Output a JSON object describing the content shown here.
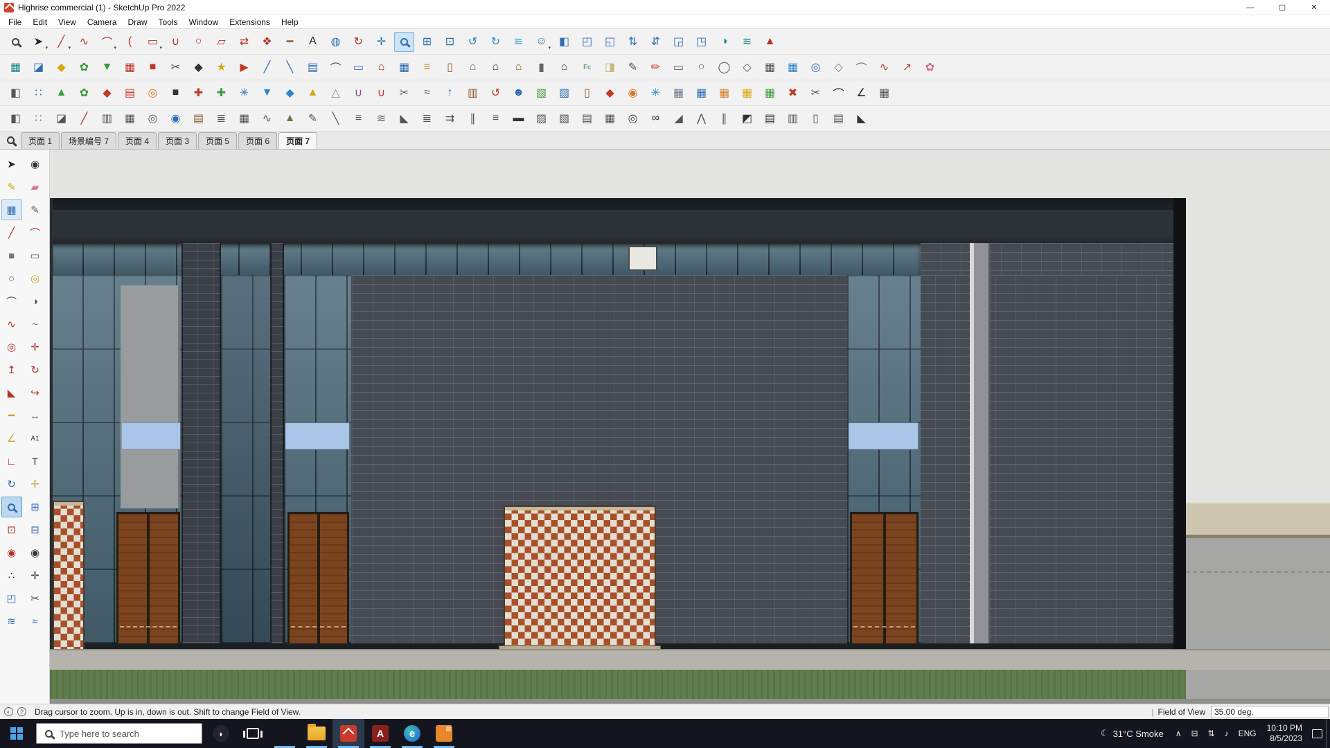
{
  "window": {
    "title": "Highrise commercial (1) - SketchUp Pro 2022",
    "controls": {
      "minimize": "—",
      "maximize": "▢",
      "close": "✕"
    }
  },
  "menu": {
    "items": [
      "File",
      "Edit",
      "View",
      "Camera",
      "Draw",
      "Tools",
      "Window",
      "Extensions",
      "Help"
    ]
  },
  "toolbars": {
    "row1": [
      {
        "n": "zoom",
        "g": "MAG",
        "c": "#444"
      },
      {
        "n": "select",
        "g": "➤",
        "c": "#222",
        "caret": true
      },
      {
        "n": "line",
        "g": "╱",
        "c": "#b3342a",
        "caret": true
      },
      {
        "n": "freehand",
        "g": "∿",
        "c": "#b3342a"
      },
      {
        "n": "arc",
        "g": "⌒",
        "c": "#b3342a",
        "caret": true
      },
      {
        "n": "two-point-arc",
        "g": "(",
        "c": "#b3342a"
      },
      {
        "n": "rectangle",
        "g": "▭",
        "c": "#b3342a",
        "caret": true
      },
      {
        "n": "weld-edges",
        "g": "∪",
        "c": "#b3342a"
      },
      {
        "n": "circle",
        "g": "○",
        "c": "#b3342a"
      },
      {
        "n": "rotated-rectangle",
        "g": "▱",
        "c": "#b3342a"
      },
      {
        "n": "flip",
        "g": "⇄",
        "c": "#b3342a"
      },
      {
        "n": "make-component",
        "g": "❖",
        "c": "#b3342a"
      },
      {
        "n": "tape-measure",
        "g": "━",
        "c": "#8a6d1a"
      },
      {
        "n": "text",
        "g": "A",
        "c": "#222"
      },
      {
        "n": "paint-bucket",
        "g": "◍",
        "c": "#2e6db4"
      },
      {
        "n": "orbit",
        "g": "↻",
        "c": "#b3342a"
      },
      {
        "n": "pan",
        "g": "✛",
        "c": "#2e6db4"
      },
      {
        "n": "zoom-tool",
        "g": "MAG",
        "c": "#2e6db4",
        "sel": true
      },
      {
        "n": "zoom-window",
        "g": "⊞",
        "c": "#2e6db4"
      },
      {
        "n": "zoom-extents",
        "g": "⊡",
        "c": "#2e6db4"
      },
      {
        "n": "previous-view",
        "g": "↺",
        "c": "#2e86c8"
      },
      {
        "n": "next-view",
        "g": "↻",
        "c": "#2e86c8"
      },
      {
        "n": "layers-water",
        "g": "≋",
        "c": "#3aa0c8"
      },
      {
        "n": "position-camera",
        "g": "☺",
        "c": "#2e6db4",
        "caret": true
      },
      {
        "n": "view-iso",
        "g": "◧",
        "c": "#2e6db4"
      },
      {
        "n": "view-top",
        "g": "◰",
        "c": "#2e6db4"
      },
      {
        "n": "view-front",
        "g": "◱",
        "c": "#2e6db4"
      },
      {
        "n": "view-up",
        "g": "⇅",
        "c": "#2e6db4"
      },
      {
        "n": "view-back",
        "g": "⇵",
        "c": "#2e6db4"
      },
      {
        "n": "view-left",
        "g": "◲",
        "c": "#2e6db4"
      },
      {
        "n": "view-bottom",
        "g": "◳",
        "c": "#2e6db4"
      },
      {
        "n": "shadows",
        "g": "◑",
        "c": "#16808a"
      },
      {
        "n": "fog",
        "g": "≋",
        "c": "#16808a"
      },
      {
        "n": "match-photo",
        "g": "▲",
        "c": "#b3342a"
      }
    ],
    "row2": [
      {
        "n": "cube-teal",
        "g": "▦",
        "c": "#1f8a8a"
      },
      {
        "n": "cube-blue",
        "g": "◪",
        "c": "#2e6db4"
      },
      {
        "n": "hex-yellow",
        "g": "◆",
        "c": "#d8a612"
      },
      {
        "n": "leaf-green",
        "g": "✿",
        "c": "#3a9a3a"
      },
      {
        "n": "drop-green",
        "g": "▼",
        "c": "#3a9a3a"
      },
      {
        "n": "box-red",
        "g": "▦",
        "c": "#c03a2a"
      },
      {
        "n": "square-red",
        "g": "■",
        "c": "#c03a2a"
      },
      {
        "n": "cut-gray",
        "g": "✂",
        "c": "#555"
      },
      {
        "n": "solid-dark",
        "g": "◆",
        "c": "#333"
      },
      {
        "n": "star-yellow",
        "g": "★",
        "c": "#d8a612"
      },
      {
        "n": "flag-red",
        "g": "▶",
        "c": "#c03a2a"
      },
      {
        "n": "slope-blue",
        "g": "╱",
        "c": "#2e6db4"
      },
      {
        "n": "slope-blue-2",
        "g": "╲",
        "c": "#2e6db4"
      },
      {
        "n": "panel-blue",
        "g": "▤",
        "c": "#2e6db4"
      },
      {
        "n": "arc-gray",
        "g": "⌒",
        "c": "#555"
      },
      {
        "n": "ruler-blue",
        "g": "▭",
        "c": "#2e6db4"
      },
      {
        "n": "roof-red",
        "g": "⌂",
        "c": "#b3342a"
      },
      {
        "n": "grid-blue",
        "g": "▦",
        "c": "#2e6db4"
      },
      {
        "n": "stairs-yellow",
        "g": "≡",
        "c": "#c08a2a"
      },
      {
        "n": "door-brown",
        "g": "▯",
        "c": "#8a5a2a"
      },
      {
        "n": "house-gray",
        "g": "⌂",
        "c": "#666"
      },
      {
        "n": "house-dark",
        "g": "⌂",
        "c": "#333"
      },
      {
        "n": "house-brown",
        "g": "⌂",
        "c": "#8a5a2a"
      },
      {
        "n": "column-gray",
        "g": "▮",
        "c": "#666"
      },
      {
        "n": "house-2",
        "g": "⌂",
        "c": "#444"
      },
      {
        "n": "fc-tool",
        "g": "Fc",
        "c": "#2e8a4a"
      },
      {
        "n": "note-tag",
        "g": "◨",
        "c": "#c8b87a"
      },
      {
        "n": "pencil-gray",
        "g": "✎",
        "c": "#555"
      },
      {
        "n": "marker-red",
        "g": "✏",
        "c": "#c03a2a"
      },
      {
        "n": "rect-outline",
        "g": "▭",
        "c": "#555"
      },
      {
        "n": "circle-outline",
        "g": "○",
        "c": "#555"
      },
      {
        "n": "ellipse-outline",
        "g": "◯",
        "c": "#555"
      },
      {
        "n": "hex-outline",
        "g": "◇",
        "c": "#555"
      },
      {
        "n": "grid-outline",
        "g": "▦",
        "c": "#555"
      },
      {
        "n": "grid-blue-2",
        "g": "▦",
        "c": "#2e86c8"
      },
      {
        "n": "target-blue",
        "g": "◎",
        "c": "#2e6db4"
      },
      {
        "n": "polygon-tool",
        "g": "◇",
        "c": "#777"
      },
      {
        "n": "arc-tool",
        "g": "⌒",
        "c": "#777"
      },
      {
        "n": "curve-red",
        "g": "∿",
        "c": "#c03a2a"
      },
      {
        "n": "arrow-red",
        "g": "↗",
        "c": "#c03a2a"
      },
      {
        "n": "pink-tool",
        "g": "✿",
        "c": "#d06a9a"
      }
    ],
    "row3": [
      {
        "n": "box-3d",
        "g": "◧",
        "c": "#555"
      },
      {
        "n": "dots-blue",
        "g": "∷",
        "c": "#2e6db4"
      },
      {
        "n": "tri-green",
        "g": "▲",
        "c": "#3a9a3a"
      },
      {
        "n": "leaf-2",
        "g": "✿",
        "c": "#3a9a3a"
      },
      {
        "n": "ruby-red",
        "g": "◆",
        "c": "#c03a2a"
      },
      {
        "n": "book-red",
        "g": "▤",
        "c": "#c03a2a"
      },
      {
        "n": "donut-orange",
        "g": "◎",
        "c": "#d87a2a"
      },
      {
        "n": "square-dark",
        "g": "■",
        "c": "#333"
      },
      {
        "n": "plus-red",
        "g": "✚",
        "c": "#c03a2a"
      },
      {
        "n": "plus-green",
        "g": "✚",
        "c": "#3a9a3a"
      },
      {
        "n": "snow-blue",
        "g": "✳",
        "c": "#2e6db4"
      },
      {
        "n": "drop-blue",
        "g": "▼",
        "c": "#2e86c8"
      },
      {
        "n": "gem-blue",
        "g": "◆",
        "c": "#2e86c8"
      },
      {
        "n": "cone-yellow",
        "g": "▲",
        "c": "#d8a612"
      },
      {
        "n": "pyramid-gray",
        "g": "△",
        "c": "#888"
      },
      {
        "n": "u-purple",
        "g": "∪",
        "c": "#8a4a9a"
      },
      {
        "n": "u-red",
        "g": "∪",
        "c": "#c03a2a"
      },
      {
        "n": "clip-gray",
        "g": "✂",
        "c": "#555"
      },
      {
        "n": "spray-gray",
        "g": "≈",
        "c": "#555"
      },
      {
        "n": "arrow-up-blue",
        "g": "↑",
        "c": "#2e6db4"
      },
      {
        "n": "box-brown",
        "g": "▥",
        "c": "#8a5a2a"
      },
      {
        "n": "swirl-red",
        "g": "↺",
        "c": "#c03a2a"
      },
      {
        "n": "people-blue",
        "g": "☻",
        "c": "#2e6db4"
      },
      {
        "n": "box-green",
        "g": "▧",
        "c": "#3a9a3a"
      },
      {
        "n": "panel-blue-2",
        "g": "▨",
        "c": "#2e6db4"
      },
      {
        "n": "door-brown-2",
        "g": "▯",
        "c": "#8a5a2a"
      },
      {
        "n": "shape-red",
        "g": "◆",
        "c": "#c03a2a"
      },
      {
        "n": "pin-orange",
        "g": "◉",
        "c": "#d87a2a"
      },
      {
        "n": "spark-blue",
        "g": "✳",
        "c": "#2e86c8"
      },
      {
        "n": "grid-steel",
        "g": "▦",
        "c": "#6a7a8a"
      },
      {
        "n": "table-blue",
        "g": "▦",
        "c": "#2e6db4"
      },
      {
        "n": "table-orange",
        "g": "▦",
        "c": "#d87a2a"
      },
      {
        "n": "table-yellow",
        "g": "▦",
        "c": "#d8a612"
      },
      {
        "n": "table-green",
        "g": "▦",
        "c": "#3a9a3a"
      },
      {
        "n": "x-red",
        "g": "✖",
        "c": "#c03a2a"
      },
      {
        "n": "scissors",
        "g": "✂",
        "c": "#555"
      },
      {
        "n": "arc-black",
        "g": "⌒",
        "c": "#222"
      },
      {
        "n": "angle-black",
        "g": "∠",
        "c": "#222"
      },
      {
        "n": "grid-end",
        "g": "▦",
        "c": "#555"
      }
    ],
    "row4": [
      {
        "n": "iso-box",
        "g": "◧",
        "c": "#555"
      },
      {
        "n": "dots-gray",
        "g": "∷",
        "c": "#777"
      },
      {
        "n": "cube-gray",
        "g": "◪",
        "c": "#555"
      },
      {
        "n": "slash-red",
        "g": "╱",
        "c": "#a33a2a"
      },
      {
        "n": "box-lines",
        "g": "▥",
        "c": "#555"
      },
      {
        "n": "box-grid",
        "g": "▦",
        "c": "#555"
      },
      {
        "n": "donut-gray",
        "g": "◎",
        "c": "#555"
      },
      {
        "n": "eye-blue",
        "g": "◉",
        "c": "#2e6db4"
      },
      {
        "n": "crate-brown",
        "g": "▤",
        "c": "#8a5a2a"
      },
      {
        "n": "stack-gray",
        "g": "≣",
        "c": "#555"
      },
      {
        "n": "fence-gray",
        "g": "▦",
        "c": "#555"
      },
      {
        "n": "wave-gray",
        "g": "∿",
        "c": "#555"
      },
      {
        "n": "terrain-green",
        "g": "▲",
        "c": "#6a7a4a"
      },
      {
        "n": "pen-gray",
        "g": "✎",
        "c": "#555"
      },
      {
        "n": "blade-gray",
        "g": "╲",
        "c": "#555"
      },
      {
        "n": "comb-gray",
        "g": "≡",
        "c": "#555"
      },
      {
        "n": "waves-gray",
        "g": "≋",
        "c": "#555"
      },
      {
        "n": "slope-gray",
        "g": "◣",
        "c": "#555"
      },
      {
        "n": "steps-gray",
        "g": "≣",
        "c": "#555"
      },
      {
        "n": "arrows-gray",
        "g": "⇉",
        "c": "#555"
      },
      {
        "n": "lines-gray",
        "g": "∥",
        "c": "#555"
      },
      {
        "n": "lines-gray-2",
        "g": "≡",
        "c": "#555"
      },
      {
        "n": "car-dark",
        "g": "▬",
        "c": "#333"
      },
      {
        "n": "hatch-gray",
        "g": "▨",
        "c": "#555"
      },
      {
        "n": "hatch-gray-2",
        "g": "▧",
        "c": "#555"
      },
      {
        "n": "stack-2",
        "g": "▤",
        "c": "#555"
      },
      {
        "n": "grid-2",
        "g": "▦",
        "c": "#555"
      },
      {
        "n": "target-dark",
        "g": "◎",
        "c": "#333"
      },
      {
        "n": "glasses-dark",
        "g": "∞",
        "c": "#333"
      },
      {
        "n": "slope-2",
        "g": "◢",
        "c": "#555"
      },
      {
        "n": "peaks-gray",
        "g": "⋀",
        "c": "#555"
      },
      {
        "n": "road-gray",
        "g": "∥",
        "c": "#555"
      },
      {
        "n": "cube-dark",
        "g": "◩",
        "c": "#333"
      },
      {
        "n": "film-dark",
        "g": "▤",
        "c": "#333"
      },
      {
        "n": "box-lines-2",
        "g": "▥",
        "c": "#555"
      },
      {
        "n": "cylinder-gray",
        "g": "▯",
        "c": "#555"
      },
      {
        "n": "panel-gray",
        "g": "▤",
        "c": "#555"
      },
      {
        "n": "tri-dark",
        "g": "◣",
        "c": "#333"
      }
    ]
  },
  "palette": {
    "tools": [
      {
        "n": "select",
        "g": "➤",
        "c": "#222"
      },
      {
        "n": "orbit-eye",
        "g": "◉",
        "c": "#333"
      },
      {
        "n": "paint",
        "g": "✎",
        "c": "#d8a612"
      },
      {
        "n": "eraser",
        "g": "▰",
        "c": "#d87a9a"
      },
      {
        "n": "textured-box",
        "g": "▦",
        "c": "#2e6db4",
        "pressed": true
      },
      {
        "n": "pencil",
        "g": "✎",
        "c": "#666"
      },
      {
        "n": "line",
        "g": "╱",
        "c": "#b3342a"
      },
      {
        "n": "arc",
        "g": "⌒",
        "c": "#b3342a"
      },
      {
        "n": "square",
        "g": "■",
        "c": "#777"
      },
      {
        "n": "rectangle",
        "g": "▭",
        "c": "#555"
      },
      {
        "n": "circle",
        "g": "○",
        "c": "#555"
      },
      {
        "n": "polygon",
        "g": "◎",
        "c": "#c8a43a"
      },
      {
        "n": "arc-2",
        "g": "⌒",
        "c": "#555"
      },
      {
        "n": "pie",
        "g": "◑",
        "c": "#555"
      },
      {
        "n": "freehand",
        "g": "∿",
        "c": "#b3342a"
      },
      {
        "n": "bezier",
        "g": "~",
        "c": "#666"
      },
      {
        "n": "offset",
        "g": "◎",
        "c": "#b3342a"
      },
      {
        "n": "move",
        "g": "✛",
        "c": "#b3342a"
      },
      {
        "n": "push-pull",
        "g": "↥",
        "c": "#b3342a"
      },
      {
        "n": "rotate",
        "g": "↻",
        "c": "#b3342a"
      },
      {
        "n": "scale",
        "g": "◣",
        "c": "#b3342a"
      },
      {
        "n": "follow-me",
        "g": "↪",
        "c": "#b3342a"
      },
      {
        "n": "tape-measure",
        "g": "━",
        "c": "#c8a43a"
      },
      {
        "n": "dimensions",
        "g": "↔",
        "c": "#666"
      },
      {
        "n": "protractor",
        "g": "∠",
        "c": "#c8a43a"
      },
      {
        "n": "text-a1",
        "g": "A1",
        "c": "#333"
      },
      {
        "n": "axes",
        "g": "∟",
        "c": "#b3342a"
      },
      {
        "n": "3d-text",
        "g": "T",
        "c": "#333"
      },
      {
        "n": "orbit",
        "g": "↻",
        "c": "#2e6db4"
      },
      {
        "n": "pan",
        "g": "✛",
        "c": "#c8a43a"
      },
      {
        "n": "zoom",
        "g": "MAG",
        "c": "#2e6db4",
        "sel": true
      },
      {
        "n": "zoom-window",
        "g": "⊞",
        "c": "#2e6db4"
      },
      {
        "n": "zoom-extents",
        "g": "⊡",
        "c": "#b3342a"
      },
      {
        "n": "zoom-previous",
        "g": "⊟",
        "c": "#2e6db4"
      },
      {
        "n": "position-camera",
        "g": "◉",
        "c": "#b3342a"
      },
      {
        "n": "look-around",
        "g": "◉",
        "c": "#333"
      },
      {
        "n": "walk",
        "g": "∴",
        "c": "#333"
      },
      {
        "n": "navigate",
        "g": "✛",
        "c": "#333"
      },
      {
        "n": "section-plane",
        "g": "◰",
        "c": "#2e6db4"
      },
      {
        "n": "section-cut",
        "g": "✂",
        "c": "#555"
      },
      {
        "n": "section-display",
        "g": "≋",
        "c": "#2e6db4"
      },
      {
        "n": "section-fill",
        "g": "≈",
        "c": "#2e6db4"
      }
    ]
  },
  "scene_bar": {
    "tabs": [
      {
        "label": "页面 1",
        "active": false
      },
      {
        "label": "场景编号 7",
        "active": false
      },
      {
        "label": "页面 4",
        "active": false
      },
      {
        "label": "页面 3",
        "active": false
      },
      {
        "label": "页面 5",
        "active": false
      },
      {
        "label": "页面 6",
        "active": false
      },
      {
        "label": "页面 7",
        "active": true
      }
    ]
  },
  "scene": {
    "colors": {
      "sky": "#e4e4e2",
      "roof_dark": "#1a1d20",
      "roof_band": "#2e3338",
      "brick": "#464a53",
      "brick_dark": "#3b3f47",
      "glass": "#4e6c7c",
      "glass_dark": "#3f5868",
      "blue_band": "#a9c6e8",
      "door": "#7c431f",
      "door_frame": "#241c12",
      "lattice_brick": "#a9502a",
      "lattice_gap": "#e3ded2",
      "concrete": "#989c9c",
      "plinth": "#b5b3ac",
      "grass": "#5f7e4b",
      "ground": "#a6a7a4",
      "tan_wall": "#cfc6b2",
      "corner": "#101214"
    }
  },
  "status_bar": {
    "geo_icon": "◐",
    "help_icon": "?",
    "hint": "Drag cursor to zoom.  Up is in, down is out. Shift to change Field of View.",
    "separator": "|",
    "field_label": "Field of View",
    "field_value": "35.00 deg."
  },
  "taskbar": {
    "search_placeholder": "Type here to search",
    "apps": [
      {
        "name": "app-bird",
        "type": "bird",
        "glyph": "◗",
        "open": false,
        "active": false
      },
      {
        "name": "task-view",
        "type": "taskview",
        "glyph": "",
        "open": false,
        "active": false
      },
      {
        "name": "app-grid",
        "type": "grid",
        "glyph": "",
        "open": true,
        "active": false
      },
      {
        "name": "file-explorer",
        "type": "folder",
        "glyph": "",
        "open": true,
        "active": false
      },
      {
        "name": "sketchup",
        "type": "sketchup",
        "glyph": "",
        "open": true,
        "active": true
      },
      {
        "name": "adobe-app",
        "type": "adobe",
        "glyph": "A",
        "open": true,
        "active": false
      },
      {
        "name": "edge-browser",
        "type": "edge",
        "glyph": "e",
        "open": true,
        "active": false
      },
      {
        "name": "orange-doc",
        "type": "doc",
        "glyph": "",
        "open": true,
        "active": false
      }
    ],
    "weather_icon": "☾",
    "weather": "31°C Smoke",
    "tray_icons": [
      {
        "name": "hidden-icons",
        "glyph": "∧"
      },
      {
        "name": "tray-device",
        "glyph": "⊟"
      },
      {
        "name": "network",
        "glyph": "⇅"
      },
      {
        "name": "volume",
        "glyph": "♪"
      }
    ],
    "language": "ENG",
    "time": "10:10 PM",
    "date": "8/5/2023"
  }
}
